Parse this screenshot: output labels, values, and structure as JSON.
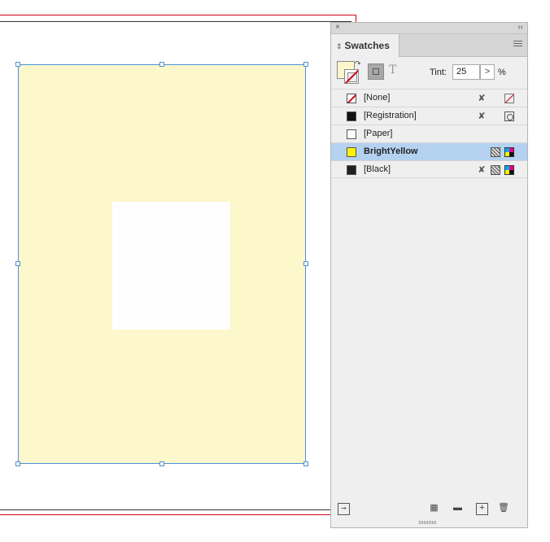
{
  "panel": {
    "tab_label": "Swatches",
    "collapse_glyph": "‹‹",
    "close_glyph": "×",
    "tint_label": "Tint:",
    "tint_value": "25",
    "tint_arrow": ">",
    "tint_unit": "%",
    "format_text_glyph": "T"
  },
  "swatches": [
    {
      "name": "[None]",
      "color": "#ffffff"
    },
    {
      "name": "[Registration]",
      "color": "#111111"
    },
    {
      "name": "[Paper]",
      "color": "#ffffff"
    },
    {
      "name": "BrightYellow",
      "color": "#fff200"
    },
    {
      "name": "[Black]",
      "color": "#231f20"
    }
  ],
  "colors": {
    "fill": "#fdf8cc",
    "selection_row": "#b4d2f0",
    "frame_border": "#4a90d9",
    "page_edge": "#d0021b"
  },
  "icons": {
    "pencil": "pencil-strike-icon",
    "none": "none-icon",
    "registration": "registration-icon",
    "process": "process-color-icon",
    "cmyk": "cmyk-icon"
  }
}
